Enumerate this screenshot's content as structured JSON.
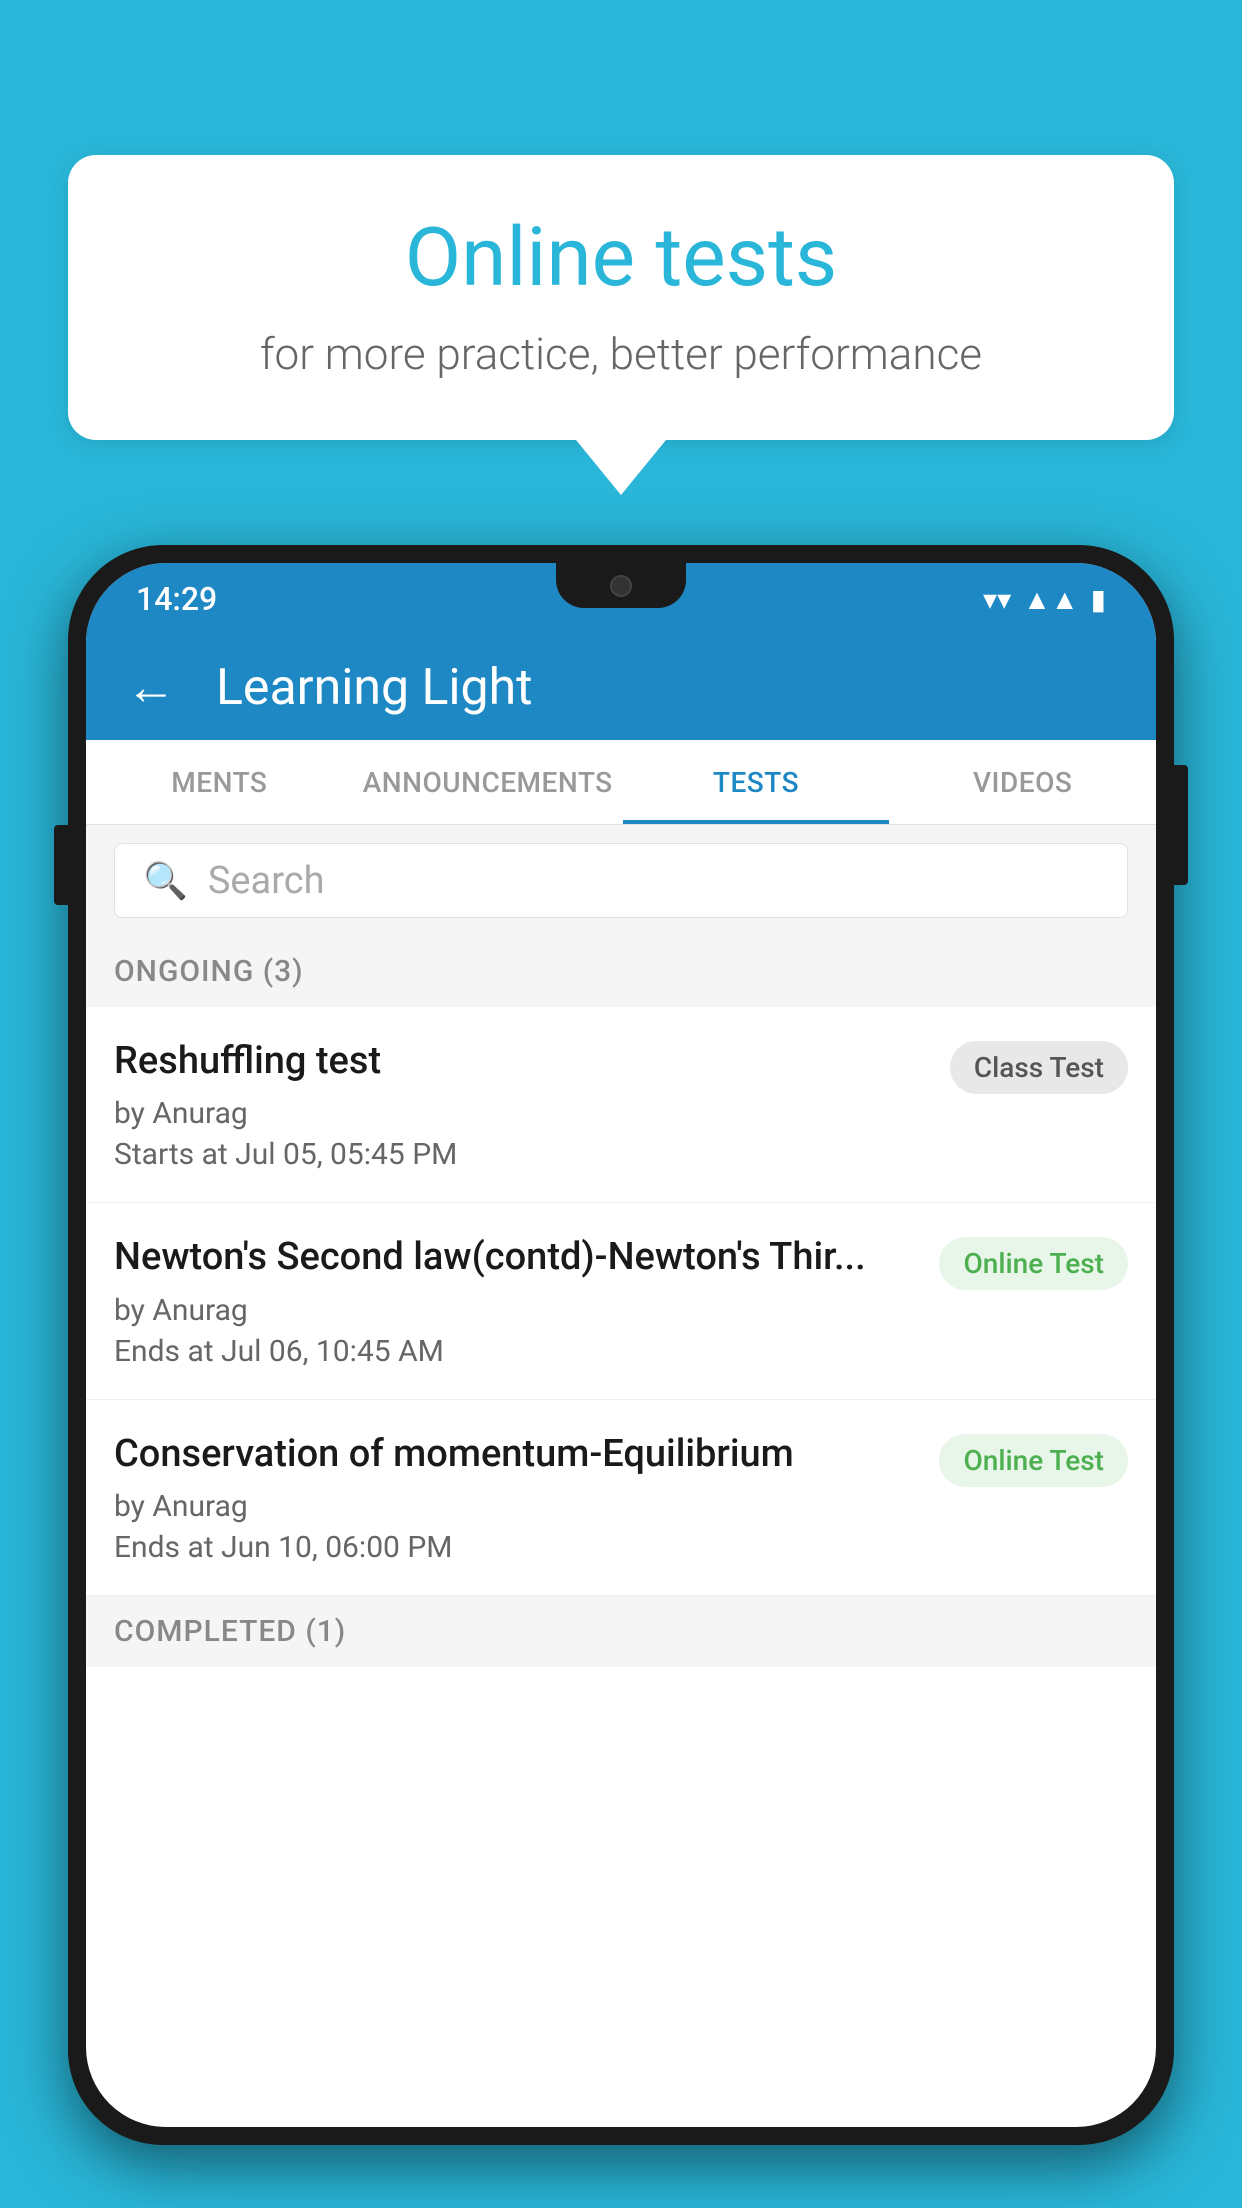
{
  "background_color": "#29b6d8",
  "speech_bubble": {
    "title": "Online tests",
    "subtitle": "for more practice, better performance"
  },
  "phone": {
    "status_bar": {
      "time": "14:29",
      "wifi_icon": "▼",
      "signal_icon": "▲",
      "battery_icon": "▮"
    },
    "header": {
      "back_label": "←",
      "title": "Learning Light"
    },
    "tabs": [
      {
        "label": "MENTS",
        "active": false
      },
      {
        "label": "ANNOUNCEMENTS",
        "active": false
      },
      {
        "label": "TESTS",
        "active": true
      },
      {
        "label": "VIDEOS",
        "active": false
      }
    ],
    "search": {
      "placeholder": "Search"
    },
    "ongoing_section": {
      "title": "ONGOING (3)"
    },
    "tests": [
      {
        "name": "Reshuffling test",
        "by": "by Anurag",
        "date": "Starts at  Jul 05, 05:45 PM",
        "badge": "Class Test",
        "badge_type": "class"
      },
      {
        "name": "Newton's Second law(contd)-Newton's Thir...",
        "by": "by Anurag",
        "date": "Ends at  Jul 06, 10:45 AM",
        "badge": "Online Test",
        "badge_type": "online"
      },
      {
        "name": "Conservation of momentum-Equilibrium",
        "by": "by Anurag",
        "date": "Ends at  Jun 10, 06:00 PM",
        "badge": "Online Test",
        "badge_type": "online"
      }
    ],
    "completed_section": {
      "title": "COMPLETED (1)"
    }
  }
}
